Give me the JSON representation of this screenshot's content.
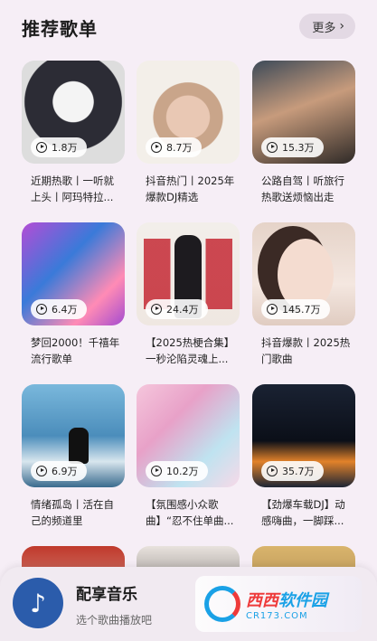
{
  "header": {
    "title": "推荐歌单",
    "more_label": "更多",
    "more_icon": "chevron-right-icon"
  },
  "playlists": [
    {
      "plays": "1.8万",
      "title": "近期热歌丨一听就上头丨阿玛特拉..."
    },
    {
      "plays": "8.7万",
      "title": "抖音热门丨2025年爆款DJ精选"
    },
    {
      "plays": "15.3万",
      "title": "公路自驾丨听旅行热歌送烦恼出走"
    },
    {
      "plays": "6.4万",
      "title": "梦回2000！千禧年流行歌单"
    },
    {
      "plays": "24.4万",
      "title": "【2025热梗合集】一秒沦陷灵魂上..."
    },
    {
      "plays": "145.7万",
      "title": "抖音爆款丨2025热门歌曲"
    },
    {
      "plays": "6.9万",
      "title": "情绪孤岛丨活在自己的频道里"
    },
    {
      "plays": "10.2万",
      "title": "【氛围感小众歌曲】“忍不住单曲..."
    },
    {
      "plays": "35.7万",
      "title": "【劲爆车载DJ】动感嗨曲，一脚踩..."
    }
  ],
  "player": {
    "title": "配享音乐",
    "subtitle": "选个歌曲播放吧",
    "icon": "music-note-icon"
  },
  "watermark": {
    "main_a": "西西",
    "main_b": "软件园",
    "domain": "CR173.COM"
  }
}
